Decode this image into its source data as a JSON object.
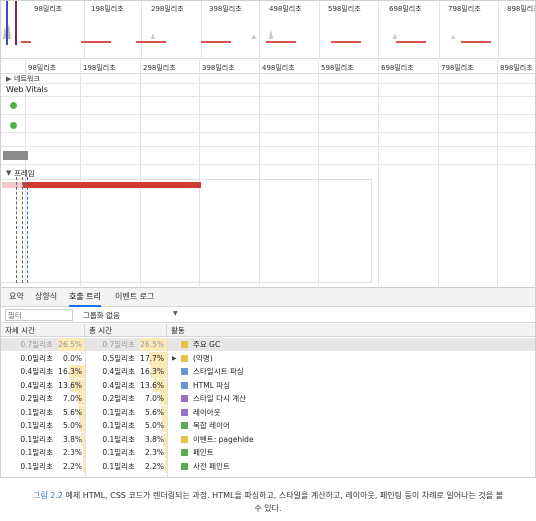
{
  "overview_ticks": [
    "98밀리초",
    "198밀리초",
    "298밀리초",
    "398밀리초",
    "498밀리초",
    "598밀리초",
    "698밀리초",
    "798밀리초",
    "898밀리초"
  ],
  "timeline_ticks": [
    "98밀리초",
    "198밀리초",
    "298밀리초",
    "398밀리초",
    "498밀리초",
    "598밀리초",
    "698밀리초",
    "798밀리초",
    "898밀리초"
  ],
  "tracks": {
    "network_label": "네트워크",
    "web_vitals_label": "Web Vitals",
    "frames_label": "프레임",
    "network_icon": "triangle-right-icon",
    "frames_icon": "triangle-down-icon"
  },
  "tabs": [
    "요약",
    "상향식",
    "호출 트리",
    "이벤트 로그"
  ],
  "active_tab": "호출 트리",
  "filter": {
    "placeholder": "필터",
    "grouping": "그룹화 없음",
    "dropdown_icon": "triangle-down-icon"
  },
  "table": {
    "headers": {
      "self": "자세 시간",
      "total": "총 시간",
      "activity": "활동"
    },
    "rows": [
      {
        "self": "0.7밀리초",
        "self_pct": "26.5%",
        "total": "0.7밀리초",
        "total_pct": "26.5%",
        "activity": "주요 GC",
        "color": "#e8c048",
        "expand": false,
        "selected": true,
        "self_frac": 0.265,
        "total_frac": 0.265
      },
      {
        "self": "0.0밀리초",
        "self_pct": "0.0%",
        "total": "0.5밀리초",
        "total_pct": "17.7%",
        "activity": "(익명)",
        "color": "#e8c048",
        "expand": true,
        "selected": false,
        "self_frac": 0,
        "total_frac": 0.177
      },
      {
        "self": "0.4밀리초",
        "self_pct": "16.3%",
        "total": "0.4밀리초",
        "total_pct": "16.3%",
        "activity": "스타일시트 파싱",
        "color": "#6a95d4",
        "expand": false,
        "selected": false,
        "self_frac": 0.163,
        "total_frac": 0.163
      },
      {
        "self": "0.4밀리초",
        "self_pct": "13.6%",
        "total": "0.4밀리초",
        "total_pct": "13.6%",
        "activity": "HTML 파싱",
        "color": "#6a95d4",
        "expand": false,
        "selected": false,
        "self_frac": 0.136,
        "total_frac": 0.136
      },
      {
        "self": "0.2밀리초",
        "self_pct": "7.0%",
        "total": "0.2밀리초",
        "total_pct": "7.0%",
        "activity": "스타일 다시 계산",
        "color": "#9a71c9",
        "expand": false,
        "selected": false,
        "self_frac": 0.07,
        "total_frac": 0.07
      },
      {
        "self": "0.1밀리초",
        "self_pct": "5.6%",
        "total": "0.1밀리초",
        "total_pct": "5.6%",
        "activity": "레이아웃",
        "color": "#9a71c9",
        "expand": false,
        "selected": false,
        "self_frac": 0.056,
        "total_frac": 0.056
      },
      {
        "self": "0.1밀리초",
        "self_pct": "5.0%",
        "total": "0.1밀리초",
        "total_pct": "5.0%",
        "activity": "복합 레이어",
        "color": "#5aab54",
        "expand": false,
        "selected": false,
        "self_frac": 0.05,
        "total_frac": 0.05
      },
      {
        "self": "0.1밀리초",
        "self_pct": "3.8%",
        "total": "0.1밀리초",
        "total_pct": "3.8%",
        "activity": "이벤트: pagehide",
        "color": "#e8c048",
        "expand": false,
        "selected": false,
        "self_frac": 0.038,
        "total_frac": 0.038
      },
      {
        "self": "0.1밀리초",
        "self_pct": "2.3%",
        "total": "0.1밀리초",
        "total_pct": "2.3%",
        "activity": "페인트",
        "color": "#5aab54",
        "expand": false,
        "selected": false,
        "self_frac": 0.023,
        "total_frac": 0.023
      },
      {
        "self": "0.1밀리초",
        "self_pct": "2.2%",
        "total": "0.1밀리초",
        "total_pct": "2.2%",
        "activity": "사전 페인트",
        "color": "#5aab54",
        "expand": false,
        "selected": false,
        "self_frac": 0.022,
        "total_frac": 0.022
      }
    ]
  },
  "caption": {
    "label": "그림 2.2",
    "text_line1": "예제 HTML, CSS 코드가 렌더링되는 과정. HTML을 파싱하고, 스타일을 계산하고, 레이아웃, 페인팅 등이 차례로 일어나는 것을 볼",
    "text_line2": "수 있다."
  }
}
